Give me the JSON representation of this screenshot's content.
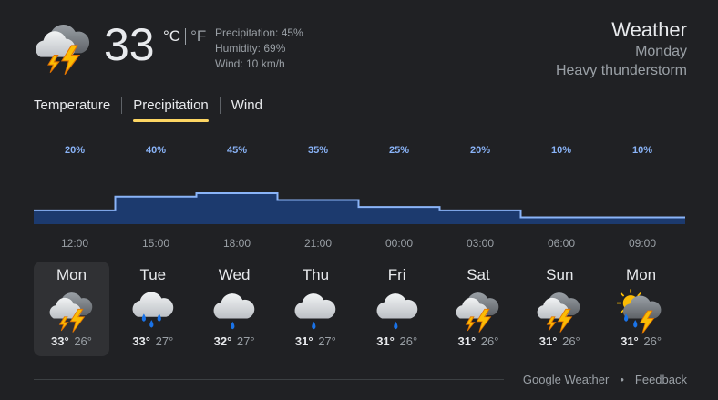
{
  "current": {
    "temperature": "33",
    "unit_c": "°C",
    "unit_f": "°F",
    "precipitation": "Precipitation: 45%",
    "humidity": "Humidity: 69%",
    "wind": "Wind: 10 km/h",
    "icon": "thunderstorm-icon"
  },
  "header": {
    "title": "Weather",
    "day": "Monday",
    "condition": "Heavy thunderstorm"
  },
  "tabs": [
    {
      "label": "Temperature",
      "active": false
    },
    {
      "label": "Precipitation",
      "active": true
    },
    {
      "label": "Wind",
      "active": false
    }
  ],
  "chart_data": {
    "type": "area",
    "x_labels": [
      "12:00",
      "15:00",
      "18:00",
      "21:00",
      "00:00",
      "03:00",
      "06:00",
      "09:00"
    ],
    "labels": [
      "20%",
      "40%",
      "45%",
      "35%",
      "25%",
      "20%",
      "10%",
      "10%"
    ],
    "values": [
      20,
      40,
      45,
      35,
      25,
      20,
      10,
      10
    ],
    "fill_color": "#1c3a6e",
    "line_color": "#8ab4f8"
  },
  "days": [
    {
      "name": "Mon",
      "hi": "33°",
      "lo": "26°",
      "icon": "thunderstorm-icon",
      "selected": true
    },
    {
      "name": "Tue",
      "hi": "33°",
      "lo": "27°",
      "icon": "rain-icon",
      "selected": false
    },
    {
      "name": "Wed",
      "hi": "32°",
      "lo": "27°",
      "icon": "showers-icon",
      "selected": false
    },
    {
      "name": "Thu",
      "hi": "31°",
      "lo": "27°",
      "icon": "showers-icon",
      "selected": false
    },
    {
      "name": "Fri",
      "hi": "31°",
      "lo": "26°",
      "icon": "showers-icon",
      "selected": false
    },
    {
      "name": "Sat",
      "hi": "31°",
      "lo": "26°",
      "icon": "thunderstorm-icon",
      "selected": false
    },
    {
      "name": "Sun",
      "hi": "31°",
      "lo": "26°",
      "icon": "thunderstorm-icon",
      "selected": false
    },
    {
      "name": "Mon",
      "hi": "31°",
      "lo": "26°",
      "icon": "sun-thunderstorm-icon",
      "selected": false
    }
  ],
  "footer": {
    "source": "Google Weather",
    "separator": "•",
    "feedback": "Feedback"
  }
}
